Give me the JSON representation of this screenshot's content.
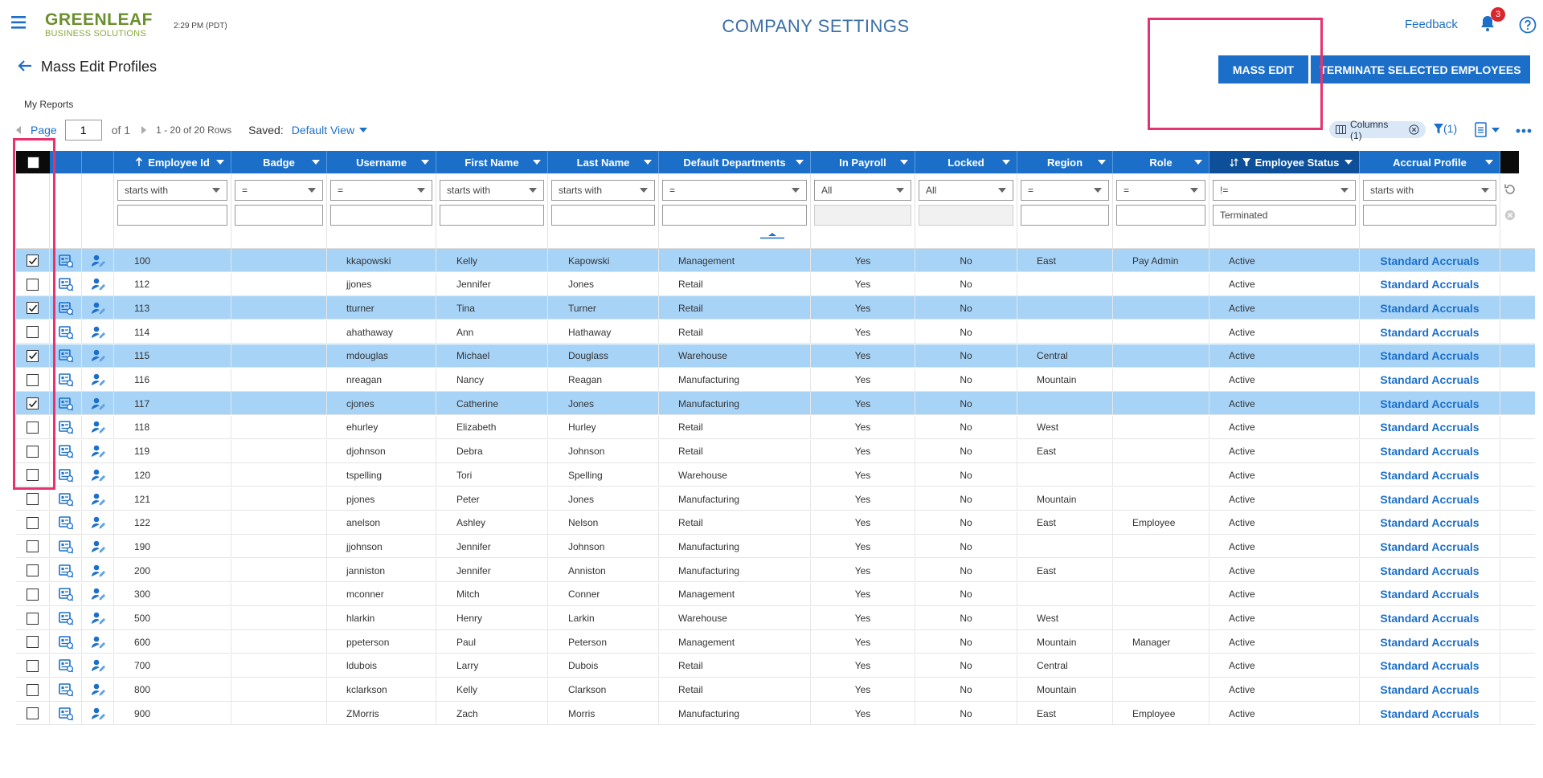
{
  "header": {
    "logo_line1": "GREENLEAF",
    "logo_line2": "BUSINESS SOLUTIONS",
    "time": "2:29 PM (PDT)",
    "title": "COMPANY SETTINGS",
    "feedback": "Feedback",
    "notification_count": "3"
  },
  "page": {
    "heading": "Mass Edit Profiles",
    "my_reports": "My Reports",
    "mass_edit_label": "MASS EDIT",
    "terminate_label": "TERMINATE SELECTED EMPLOYEES"
  },
  "pager": {
    "label": "Page",
    "page_value": "1",
    "of_text": "of 1",
    "rows_text": "1 - 20 of 20 Rows",
    "saved_label": "Saved:",
    "saved_view": "Default View"
  },
  "toolbar": {
    "columns_chip": "Columns (1)",
    "filter_count": "(1)"
  },
  "columns": [
    {
      "key": "employee_id",
      "label": "Employee Id",
      "filter_op": "starts with",
      "filter_value": ""
    },
    {
      "key": "badge",
      "label": "Badge",
      "filter_op": "=",
      "filter_value": ""
    },
    {
      "key": "username",
      "label": "Username",
      "filter_op": "=",
      "filter_value": ""
    },
    {
      "key": "first_name",
      "label": "First Name",
      "filter_op": "starts with",
      "filter_value": ""
    },
    {
      "key": "last_name",
      "label": "Last Name",
      "filter_op": "starts with",
      "filter_value": ""
    },
    {
      "key": "default_departments",
      "label": "Default Departments",
      "filter_op": "=",
      "filter_value": ""
    },
    {
      "key": "in_payroll",
      "label": "In Payroll",
      "filter_op": "All",
      "filter_value": ""
    },
    {
      "key": "locked",
      "label": "Locked",
      "filter_op": "All",
      "filter_value": ""
    },
    {
      "key": "region",
      "label": "Region",
      "filter_op": "=",
      "filter_value": ""
    },
    {
      "key": "role",
      "label": "Role",
      "filter_op": "=",
      "filter_value": ""
    },
    {
      "key": "employee_status",
      "label": "Employee Status",
      "filter_op": "!=",
      "filter_value": "Terminated"
    },
    {
      "key": "accrual_profile",
      "label": "Accrual Profile",
      "filter_op": "starts with",
      "filter_value": ""
    }
  ],
  "rows": [
    {
      "checked": true,
      "employee_id": "100",
      "badge": "",
      "username": "kkapowski",
      "first_name": "Kelly",
      "last_name": "Kapowski",
      "default_departments": "Management",
      "in_payroll": "Yes",
      "locked": "No",
      "region": "East",
      "role": "Pay Admin",
      "employee_status": "Active",
      "accrual_profile": "Standard Accruals"
    },
    {
      "checked": false,
      "employee_id": "112",
      "badge": "",
      "username": "jjones",
      "first_name": "Jennifer",
      "last_name": "Jones",
      "default_departments": "Retail",
      "in_payroll": "Yes",
      "locked": "No",
      "region": "",
      "role": "",
      "employee_status": "Active",
      "accrual_profile": "Standard Accruals"
    },
    {
      "checked": true,
      "employee_id": "113",
      "badge": "",
      "username": "tturner",
      "first_name": "Tina",
      "last_name": "Turner",
      "default_departments": "Retail",
      "in_payroll": "Yes",
      "locked": "No",
      "region": "",
      "role": "",
      "employee_status": "Active",
      "accrual_profile": "Standard Accruals"
    },
    {
      "checked": false,
      "employee_id": "114",
      "badge": "",
      "username": "ahathaway",
      "first_name": "Ann",
      "last_name": "Hathaway",
      "default_departments": "Retail",
      "in_payroll": "Yes",
      "locked": "No",
      "region": "",
      "role": "",
      "employee_status": "Active",
      "accrual_profile": "Standard Accruals"
    },
    {
      "checked": true,
      "employee_id": "115",
      "badge": "",
      "username": "mdouglas",
      "first_name": "Michael",
      "last_name": "Douglass",
      "default_departments": "Warehouse",
      "in_payroll": "Yes",
      "locked": "No",
      "region": "Central",
      "role": "",
      "employee_status": "Active",
      "accrual_profile": "Standard Accruals"
    },
    {
      "checked": false,
      "employee_id": "116",
      "badge": "",
      "username": "nreagan",
      "first_name": "Nancy",
      "last_name": "Reagan",
      "default_departments": "Manufacturing",
      "in_payroll": "Yes",
      "locked": "No",
      "region": "Mountain",
      "role": "",
      "employee_status": "Active",
      "accrual_profile": "Standard Accruals"
    },
    {
      "checked": true,
      "employee_id": "117",
      "badge": "",
      "username": "cjones",
      "first_name": "Catherine",
      "last_name": "Jones",
      "default_departments": "Manufacturing",
      "in_payroll": "Yes",
      "locked": "No",
      "region": "",
      "role": "",
      "employee_status": "Active",
      "accrual_profile": "Standard Accruals"
    },
    {
      "checked": false,
      "employee_id": "118",
      "badge": "",
      "username": "ehurley",
      "first_name": "Elizabeth",
      "last_name": "Hurley",
      "default_departments": "Retail",
      "in_payroll": "Yes",
      "locked": "No",
      "region": "West",
      "role": "",
      "employee_status": "Active",
      "accrual_profile": "Standard Accruals"
    },
    {
      "checked": false,
      "employee_id": "119",
      "badge": "",
      "username": "djohnson",
      "first_name": "Debra",
      "last_name": "Johnson",
      "default_departments": "Retail",
      "in_payroll": "Yes",
      "locked": "No",
      "region": "East",
      "role": "",
      "employee_status": "Active",
      "accrual_profile": "Standard Accruals"
    },
    {
      "checked": false,
      "employee_id": "120",
      "badge": "",
      "username": "tspelling",
      "first_name": "Tori",
      "last_name": "Spelling",
      "default_departments": "Warehouse",
      "in_payroll": "Yes",
      "locked": "No",
      "region": "",
      "role": "",
      "employee_status": "Active",
      "accrual_profile": "Standard Accruals"
    },
    {
      "checked": false,
      "employee_id": "121",
      "badge": "",
      "username": "pjones",
      "first_name": "Peter",
      "last_name": "Jones",
      "default_departments": "Manufacturing",
      "in_payroll": "Yes",
      "locked": "No",
      "region": "Mountain",
      "role": "",
      "employee_status": "Active",
      "accrual_profile": "Standard Accruals"
    },
    {
      "checked": false,
      "employee_id": "122",
      "badge": "",
      "username": "anelson",
      "first_name": "Ashley",
      "last_name": "Nelson",
      "default_departments": "Retail",
      "in_payroll": "Yes",
      "locked": "No",
      "region": "East",
      "role": "Employee",
      "employee_status": "Active",
      "accrual_profile": "Standard Accruals"
    },
    {
      "checked": false,
      "employee_id": "190",
      "badge": "",
      "username": "jjohnson",
      "first_name": "Jennifer",
      "last_name": "Johnson",
      "default_departments": "Manufacturing",
      "in_payroll": "Yes",
      "locked": "No",
      "region": "",
      "role": "",
      "employee_status": "Active",
      "accrual_profile": "Standard Accruals"
    },
    {
      "checked": false,
      "employee_id": "200",
      "badge": "",
      "username": "janniston",
      "first_name": "Jennifer",
      "last_name": "Anniston",
      "default_departments": "Manufacturing",
      "in_payroll": "Yes",
      "locked": "No",
      "region": "East",
      "role": "",
      "employee_status": "Active",
      "accrual_profile": "Standard Accruals"
    },
    {
      "checked": false,
      "employee_id": "300",
      "badge": "",
      "username": "mconner",
      "first_name": "Mitch",
      "last_name": "Conner",
      "default_departments": "Management",
      "in_payroll": "Yes",
      "locked": "No",
      "region": "",
      "role": "",
      "employee_status": "Active",
      "accrual_profile": "Standard Accruals"
    },
    {
      "checked": false,
      "employee_id": "500",
      "badge": "",
      "username": "hlarkin",
      "first_name": "Henry",
      "last_name": "Larkin",
      "default_departments": "Warehouse",
      "in_payroll": "Yes",
      "locked": "No",
      "region": "West",
      "role": "",
      "employee_status": "Active",
      "accrual_profile": "Standard Accruals"
    },
    {
      "checked": false,
      "employee_id": "600",
      "badge": "",
      "username": "ppeterson",
      "first_name": "Paul",
      "last_name": "Peterson",
      "default_departments": "Management",
      "in_payroll": "Yes",
      "locked": "No",
      "region": "Mountain",
      "role": "Manager",
      "employee_status": "Active",
      "accrual_profile": "Standard Accruals"
    },
    {
      "checked": false,
      "employee_id": "700",
      "badge": "",
      "username": "ldubois",
      "first_name": "Larry",
      "last_name": "Dubois",
      "default_departments": "Retail",
      "in_payroll": "Yes",
      "locked": "No",
      "region": "Central",
      "role": "",
      "employee_status": "Active",
      "accrual_profile": "Standard Accruals"
    },
    {
      "checked": false,
      "employee_id": "800",
      "badge": "",
      "username": "kclarkson",
      "first_name": "Kelly",
      "last_name": "Clarkson",
      "default_departments": "Retail",
      "in_payroll": "Yes",
      "locked": "No",
      "region": "Mountain",
      "role": "",
      "employee_status": "Active",
      "accrual_profile": "Standard Accruals"
    },
    {
      "checked": false,
      "employee_id": "900",
      "badge": "",
      "username": "ZMorris",
      "first_name": "Zach",
      "last_name": "Morris",
      "default_departments": "Manufacturing",
      "in_payroll": "Yes",
      "locked": "No",
      "region": "East",
      "role": "Employee",
      "employee_status": "Active",
      "accrual_profile": "Standard Accruals"
    }
  ],
  "colors": {
    "accent": "#1c6fc9",
    "selected_row": "#a7d3f7",
    "highlight_box": "#e8326d",
    "logo_green": "#6a8f2d"
  },
  "icons": [
    "menu-icon",
    "bell-icon",
    "help-icon",
    "back-arrow-icon",
    "columns-icon",
    "filter-icon",
    "export-icon",
    "more-icon",
    "profile-card-icon",
    "user-edit-icon",
    "refresh-icon",
    "clear-icon"
  ]
}
